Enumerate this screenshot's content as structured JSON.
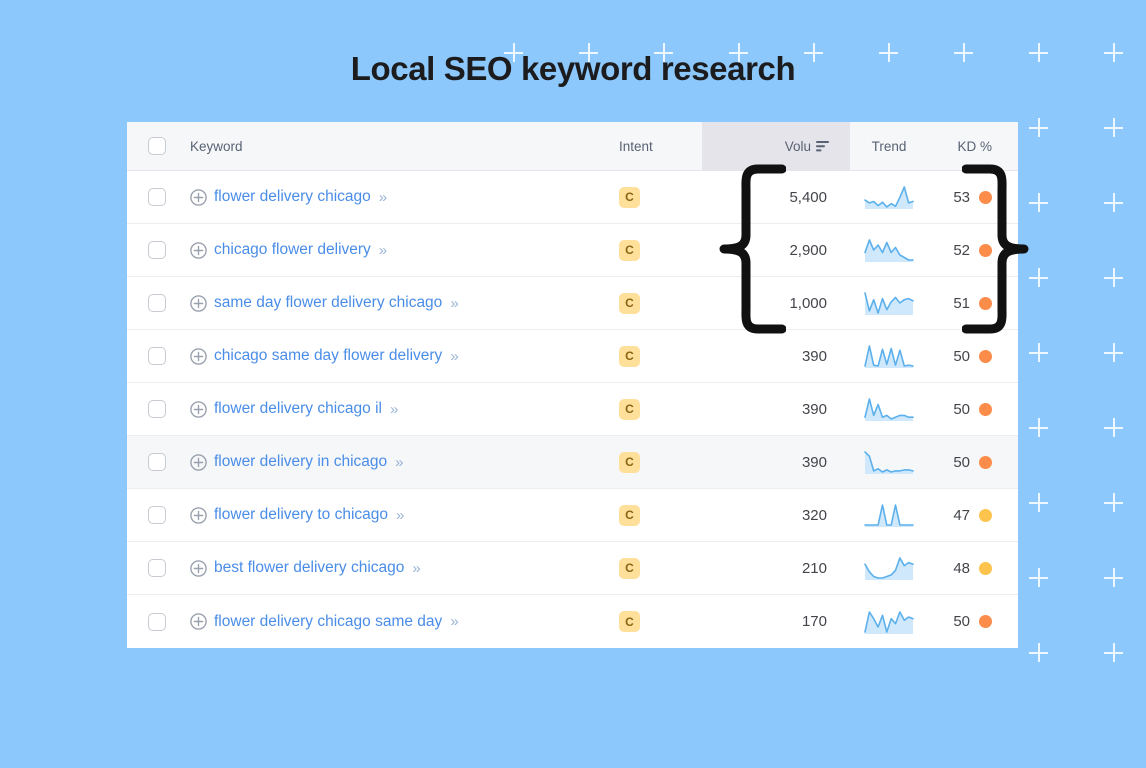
{
  "page": {
    "title": "Local SEO keyword research",
    "background_color": "#8cc8fb",
    "decor_icon": "plus-icon"
  },
  "table": {
    "columns": [
      {
        "key": "select",
        "label": "",
        "icon": "checkbox-icon"
      },
      {
        "key": "keyword",
        "label": "Keyword"
      },
      {
        "key": "intent",
        "label": "Intent"
      },
      {
        "key": "volume",
        "label": "Volu",
        "sorted": true,
        "sort_icon": "sort-descending-icon"
      },
      {
        "key": "trend",
        "label": "Trend"
      },
      {
        "key": "kd",
        "label": "KD %"
      }
    ],
    "rows": [
      {
        "keyword": "flower delivery chicago",
        "intent": "C",
        "volume": "5,400",
        "kd": "53",
        "kd_color": "#fb8c4a",
        "hovered": false,
        "trend": "22,18,20,14,19,12,17,13,26,41,18,20"
      },
      {
        "keyword": "chicago flower delivery",
        "intent": "C",
        "volume": "2,900",
        "kd": "52",
        "kd_color": "#fb8c4a",
        "hovered": false,
        "trend": "13,18,14,16,13,17,13,15,12,11,10,10"
      },
      {
        "keyword": "same day flower delivery chicago",
        "intent": "C",
        "volume": "1,000",
        "kd": "51",
        "kd_color": "#fb8c4a",
        "hovered": false,
        "trend": "30,14,24,12,25,15,22,26,21,24,25,23"
      },
      {
        "keyword": "chicago same day flower delivery",
        "intent": "C",
        "volume": "390",
        "kd": "50",
        "kd_color": "#fb8c4a",
        "hovered": false,
        "trend": "10,34,11,10,30,12,31,11,29,10,11,10"
      },
      {
        "keyword": "flower delivery chicago il",
        "intent": "C",
        "volume": "390",
        "kd": "50",
        "kd_color": "#fb8c4a",
        "hovered": false,
        "trend": "12,22,13,19,12,13,11,12,13,13,12,12"
      },
      {
        "keyword": "flower delivery in chicago",
        "intent": "C",
        "volume": "390",
        "kd": "50",
        "kd_color": "#fb8c4a",
        "hovered": true,
        "trend": "30,26,12,14,11,13,11,12,12,13,13,12"
      },
      {
        "keyword": "flower delivery to chicago",
        "intent": "C",
        "volume": "320",
        "kd": "47",
        "kd_color": "#fcc44c",
        "hovered": false,
        "trend": "11,11,11,11,12,11,11,12,11,11,11,11"
      },
      {
        "keyword": "best flower delivery chicago",
        "intent": "C",
        "volume": "210",
        "kd": "48",
        "kd_color": "#fcc44c",
        "hovered": false,
        "trend": "21,16,13,12,12,13,14,17,25,20,22,21"
      },
      {
        "keyword": "flower delivery chicago same day",
        "intent": "C",
        "volume": "170",
        "kd": "50",
        "kd_color": "#fb8c4a",
        "hovered": false,
        "trend": "14,26,22,17,24,14,22,19,26,21,23,22"
      }
    ],
    "row_icons": {
      "add": "add-circle-icon",
      "expand": "chevron-double-right-icon",
      "select": "checkbox-icon"
    },
    "expand_glyph": "»"
  },
  "annotations": [
    {
      "name": "brace-left",
      "shape": "curly-brace-left",
      "rows": [
        "flower delivery chicago",
        "chicago flower delivery",
        "same day flower delivery chicago"
      ]
    },
    {
      "name": "brace-right",
      "shape": "curly-brace-right",
      "rows": [
        "flower delivery chicago",
        "chicago flower delivery",
        "same day flower delivery chicago"
      ]
    }
  ]
}
